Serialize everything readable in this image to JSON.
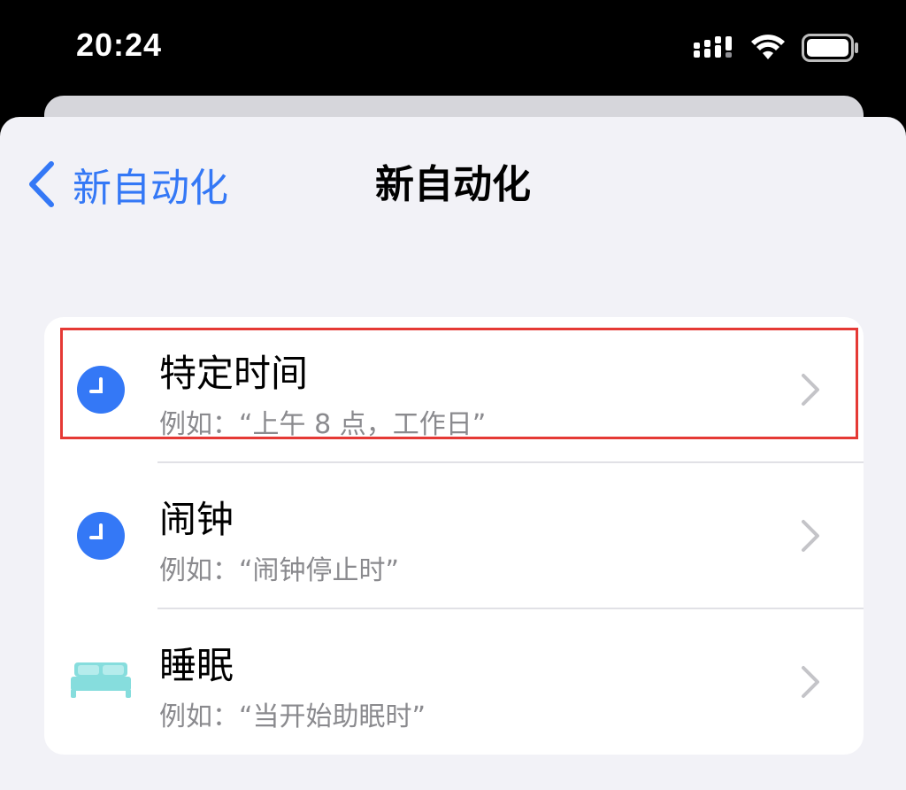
{
  "status_bar": {
    "time": "20:24",
    "icons": [
      "cellular-signal-icon",
      "wifi-icon",
      "battery-icon"
    ]
  },
  "nav": {
    "back_label": "新自动化",
    "title": "新自动化"
  },
  "items": [
    {
      "title": "特定时间",
      "subtitle": "例如：“上午 8 点，工作日”",
      "icon": "clock-icon",
      "icon_color": "#3478f6",
      "selected": true
    },
    {
      "title": "闹钟",
      "subtitle": "例如：“闹钟停止时”",
      "icon": "clock-icon",
      "icon_color": "#3478f6"
    },
    {
      "title": "睡眠",
      "subtitle": "例如：“当开始助眠时”",
      "icon": "bed-icon",
      "icon_color": "#86dddd"
    }
  ],
  "colors": {
    "accent": "#3478f6",
    "highlight": "#e53935",
    "sheet_background": "#f2f2f7"
  }
}
